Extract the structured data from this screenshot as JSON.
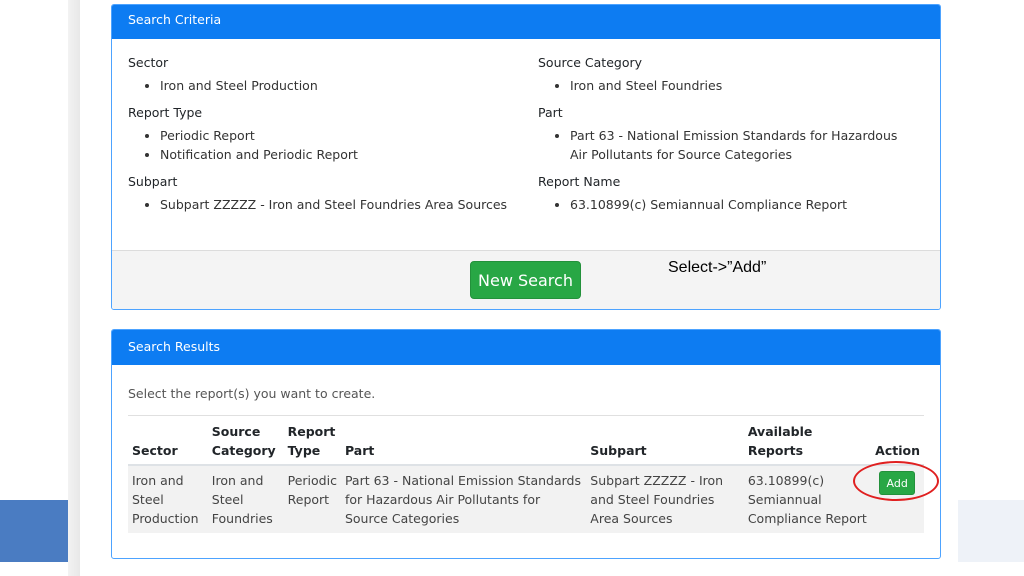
{
  "criteria": {
    "header": "Search Criteria",
    "sector_label": "Sector",
    "sector_items": [
      "Iron and Steel Production"
    ],
    "report_type_label": "Report Type",
    "report_type_items": [
      "Periodic Report",
      "Notification and Periodic Report"
    ],
    "subpart_label": "Subpart",
    "subpart_items": [
      "Subpart ZZZZZ - Iron and Steel Foundries Area Sources"
    ],
    "source_category_label": "Source Category",
    "source_category_items": [
      "Iron and Steel Foundries"
    ],
    "part_label": "Part",
    "part_items": [
      "Part 63 - National Emission Standards for Hazardous Air Pollutants for Source Categories"
    ],
    "report_name_label": "Report Name",
    "report_name_items": [
      "63.10899(c) Semiannual Compliance Report"
    ],
    "new_search_label": "New Search"
  },
  "annotation": "Select->”Add”",
  "results": {
    "header": "Search Results",
    "instruction": "Select the report(s) you want to create.",
    "columns": {
      "sector": "Sector",
      "source_category": "Source Category",
      "report_type": "Report Type",
      "part": "Part",
      "subpart": "Subpart",
      "available_reports": "Available Reports",
      "action": "Action"
    },
    "rows": [
      {
        "sector": "Iron and Steel Production",
        "source_category": "Iron and Steel Foundries",
        "report_type": "Periodic Report",
        "part": "Part 63 - National Emission Standards for Hazardous Air Pollutants for Source Categories",
        "subpart": "Subpart ZZZZZ - Iron and Steel Foundries Area Sources",
        "available_reports": "63.10899(c) Semiannual Compliance Report",
        "action_label": "Add"
      }
    ]
  },
  "colors": {
    "header_blue": "#0d7cf2",
    "button_green": "#28a745",
    "highlight_red": "#e02020"
  }
}
